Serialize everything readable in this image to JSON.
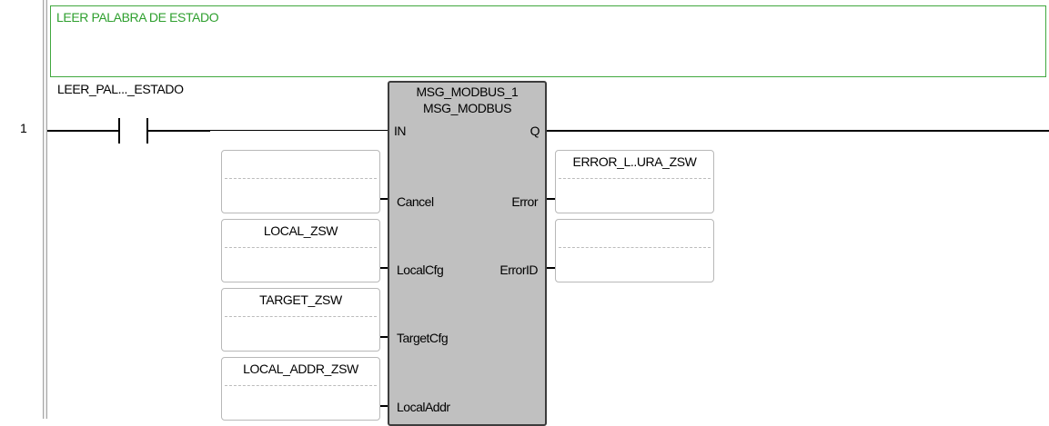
{
  "rung": {
    "number": "1"
  },
  "comment": "LEER PALABRA DE ESTADO",
  "contact": {
    "label": "LEER_PAL..._ESTADO"
  },
  "function_block": {
    "instance": "MSG_MODBUS_1",
    "type": "MSG_MODBUS",
    "inputs": [
      {
        "pin": "IN"
      },
      {
        "pin": "Cancel",
        "variable": ""
      },
      {
        "pin": "LocalCfg",
        "variable": "LOCAL_ZSW"
      },
      {
        "pin": "TargetCfg",
        "variable": "TARGET_ZSW"
      },
      {
        "pin": "LocalAddr",
        "variable": "LOCAL_ADDR_ZSW"
      }
    ],
    "outputs": [
      {
        "pin": "Q"
      },
      {
        "pin": "Error",
        "variable": "ERROR_L..URA_ZSW"
      },
      {
        "pin": "ErrorID",
        "variable": ""
      }
    ]
  },
  "colors": {
    "comment_border": "#41a83e",
    "comment_text": "#2e9f2e",
    "block_fill": "#c0c0c0"
  }
}
